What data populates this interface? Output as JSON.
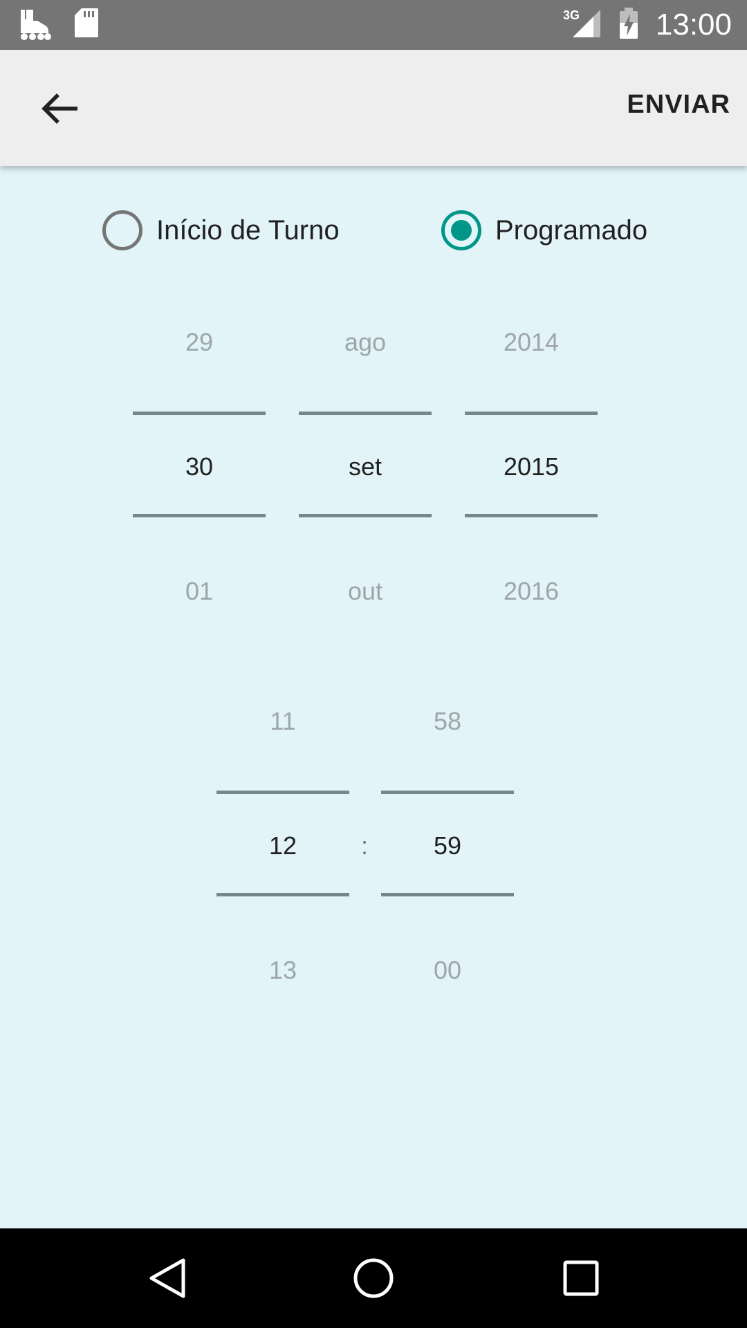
{
  "status_bar": {
    "time": "13:00",
    "network": "3G",
    "icons": [
      "roller-skate-icon",
      "sd-card-icon",
      "signal-3g-icon",
      "battery-charging-icon"
    ]
  },
  "app_bar": {
    "back_icon": "arrow-left-icon",
    "send_label": "ENVIAR"
  },
  "radio_options": [
    {
      "label": "Início de Turno",
      "checked": false
    },
    {
      "label": "Programado",
      "checked": true
    }
  ],
  "date_picker": {
    "day": {
      "prev": "29",
      "current": "30",
      "next": "01"
    },
    "month": {
      "prev": "ago",
      "current": "set",
      "next": "out"
    },
    "year": {
      "prev": "2014",
      "current": "2015",
      "next": "2016"
    }
  },
  "time_picker": {
    "hour": {
      "prev": "11",
      "current": "12",
      "next": "13"
    },
    "separator": ":",
    "minute": {
      "prev": "58",
      "current": "59",
      "next": "00"
    }
  },
  "nav_bar": {
    "icons": [
      "back-triangle-icon",
      "home-circle-icon",
      "recents-square-icon"
    ]
  },
  "colors": {
    "accent": "#009688",
    "background": "#e2f4f8",
    "app_bar": "#eeeeee",
    "status_bar": "#757575"
  }
}
